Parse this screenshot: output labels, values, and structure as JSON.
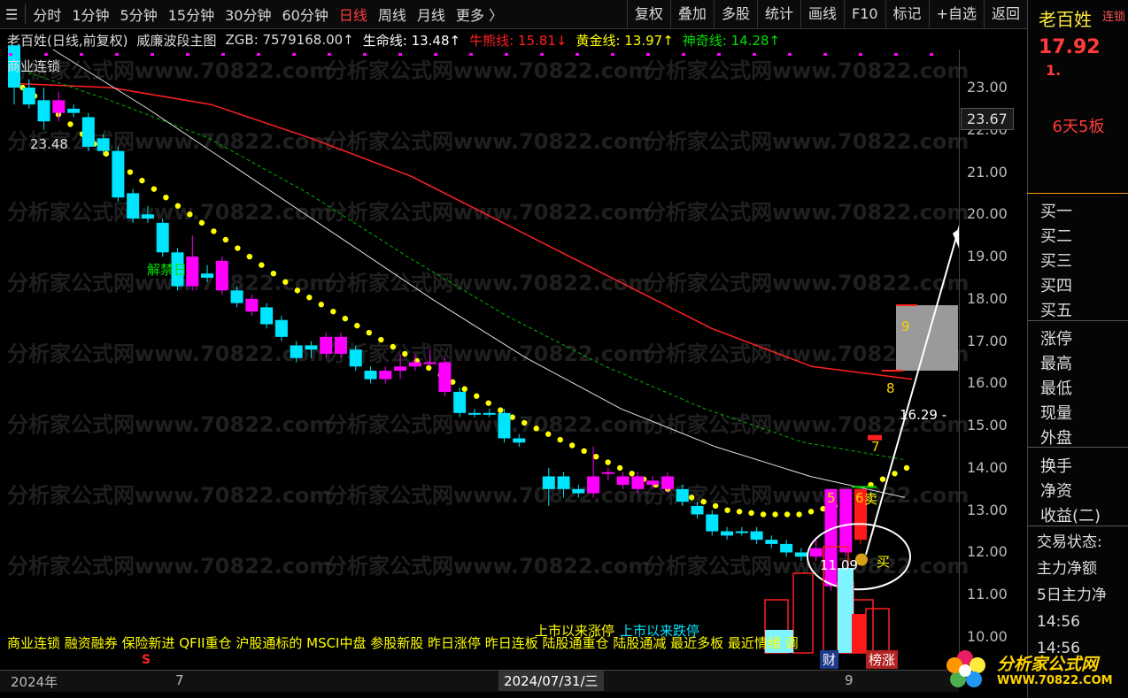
{
  "toolbar": {
    "tabs": [
      "分时",
      "1分钟",
      "5分钟",
      "15分钟",
      "30分钟",
      "60分钟",
      "日线",
      "周线",
      "月线",
      "更多 〉"
    ],
    "active_tab": "日线",
    "right_buttons": [
      "复权",
      "叠加",
      "多股",
      "统计",
      "画线",
      "F10",
      "标记",
      "+自选",
      "返回"
    ]
  },
  "legend": {
    "stock": "老百姓(日线,前复权)",
    "indicator": "威廉波段主图",
    "zgb": "ZGB: 7579168.00↑",
    "life": "生命线: 13.48↑",
    "bull": "牛熊线: 15.81↓",
    "gold": "黄金线: 13.97↑",
    "magic": "神奇线: 14.28↑"
  },
  "labels": {
    "sector": "商业连锁",
    "high_price": "23.48",
    "low_price": "11.09",
    "unlock_day": "解禁日",
    "buy": "买",
    "sell": "卖",
    "target": "16.29 -",
    "limit_up_text": "上市以来涨停",
    "limit_down_text": "上市以来跌停",
    "signal_s": "S",
    "signal_9": "9",
    "signal_8": "8",
    "signal_7": "7",
    "signal_5": "5",
    "signal_6": "6",
    "badge_cai": "财",
    "badge_bang": "榜涨"
  },
  "concept_strip": "商业连锁 融资融券 保险新进 QFII重仓 沪股通标的 MSCI中盘 参股新股 昨日涨停 昨日连板 陆股通重仓 陆股通减 最近多板 最近情绪 调",
  "price_axis": {
    "top_tag": "23.67",
    "ticks": [
      "23.00",
      "22.00",
      "21.00",
      "20.00",
      "19.00",
      "18.00",
      "17.00",
      "16.00",
      "15.00",
      "14.00",
      "13.00",
      "12.00",
      "11.00",
      "10.00"
    ]
  },
  "bottom_bar": {
    "year": "2024年",
    "month_mark": "7",
    "date": "2024/07/31/三",
    "month_end": "9"
  },
  "side_panel": {
    "name": "老百姓",
    "limit_tag": "连锁",
    "price": "17.92",
    "price_suffix": "1.",
    "board": "6天5板",
    "orders": [
      "买一",
      "买二",
      "买三",
      "买四",
      "买五"
    ],
    "quote": [
      "涨停",
      "最高",
      "最低",
      "现量",
      "外盘"
    ],
    "finance": [
      "换手",
      "净资",
      "收益(二)"
    ],
    "trade_title": "交易状态:",
    "trade": [
      "主力净额",
      "5日主力净",
      "14:56",
      "14:56"
    ]
  },
  "watermark": "分析家公式网www.70822.com",
  "logo": {
    "name": "分析家公式网",
    "url": "WWW.70822.COM"
  },
  "colors": {
    "up": "#ff00ff",
    "down": "#00e5ff",
    "red": "#ff2020",
    "yellow": "#ffff00",
    "green": "#00c000",
    "white": "#e0e0e0"
  },
  "chart_data": {
    "type": "candlestick",
    "ylim": [
      10,
      23.9
    ],
    "candles": [
      [
        24.0,
        23.0,
        24.0,
        22.6,
        "d"
      ],
      [
        23.0,
        22.6,
        23.2,
        22.5,
        "d"
      ],
      [
        22.7,
        22.2,
        23.0,
        22.0,
        "d"
      ],
      [
        22.4,
        22.7,
        22.9,
        22.2,
        "u"
      ],
      [
        22.5,
        22.4,
        22.6,
        22.3,
        "d"
      ],
      [
        22.3,
        21.6,
        22.4,
        21.5,
        "d"
      ],
      [
        21.8,
        21.5,
        21.9,
        21.4,
        "d"
      ],
      [
        21.5,
        20.4,
        21.6,
        20.3,
        "d"
      ],
      [
        20.5,
        19.9,
        20.6,
        19.8,
        "d"
      ],
      [
        20.0,
        19.9,
        20.2,
        19.8,
        "d"
      ],
      [
        19.8,
        19.1,
        19.9,
        19.0,
        "d"
      ],
      [
        19.1,
        18.3,
        19.2,
        18.2,
        "d"
      ],
      [
        18.3,
        19.0,
        19.5,
        18.2,
        "u"
      ],
      [
        18.5,
        18.6,
        18.8,
        18.4,
        "d"
      ],
      [
        18.9,
        18.2,
        19.0,
        18.1,
        "u"
      ],
      [
        18.2,
        17.9,
        18.3,
        17.8,
        "d"
      ],
      [
        18.0,
        17.7,
        18.1,
        17.6,
        "u"
      ],
      [
        17.8,
        17.4,
        17.9,
        17.3,
        "d"
      ],
      [
        17.5,
        17.1,
        17.6,
        17.0,
        "d"
      ],
      [
        16.9,
        16.6,
        17.0,
        16.5,
        "d"
      ],
      [
        16.8,
        16.9,
        17.0,
        16.6,
        "d"
      ],
      [
        16.7,
        17.1,
        17.2,
        16.6,
        "u"
      ],
      [
        17.1,
        16.7,
        17.2,
        16.6,
        "u"
      ],
      [
        16.8,
        16.4,
        16.9,
        16.3,
        "d"
      ],
      [
        16.3,
        16.1,
        16.4,
        16.0,
        "d"
      ],
      [
        16.1,
        16.3,
        16.4,
        16.0,
        "u"
      ],
      [
        16.3,
        16.4,
        16.7,
        16.1,
        "u"
      ],
      [
        16.4,
        16.5,
        16.7,
        16.3,
        "u"
      ],
      [
        16.5,
        16.5,
        16.8,
        16.4,
        "u"
      ],
      [
        16.5,
        15.8,
        16.6,
        15.7,
        "u"
      ],
      [
        15.8,
        15.3,
        15.9,
        15.2,
        "d"
      ],
      [
        15.3,
        15.3,
        15.4,
        15.2,
        "d"
      ],
      [
        15.3,
        15.3,
        15.4,
        15.2,
        "d"
      ],
      [
        15.3,
        14.7,
        15.4,
        14.6,
        "d"
      ],
      [
        14.7,
        14.6,
        14.8,
        14.5,
        "d"
      ],
      [
        null,
        null,
        null,
        null,
        "x"
      ],
      [
        13.8,
        13.5,
        14.0,
        13.1,
        "d"
      ],
      [
        13.8,
        13.5,
        13.9,
        13.3,
        "d"
      ],
      [
        13.5,
        13.4,
        13.6,
        13.3,
        "d"
      ],
      [
        13.4,
        13.8,
        14.5,
        13.3,
        "u"
      ],
      [
        13.9,
        13.9,
        14.0,
        13.7,
        "u"
      ],
      [
        13.8,
        13.6,
        13.9,
        13.5,
        "u"
      ],
      [
        13.5,
        13.8,
        13.9,
        13.4,
        "u"
      ],
      [
        13.7,
        13.6,
        13.8,
        13.5,
        "u"
      ],
      [
        13.8,
        13.5,
        13.9,
        13.4,
        "u"
      ],
      [
        13.5,
        13.2,
        13.6,
        13.1,
        "d"
      ],
      [
        13.1,
        12.9,
        13.2,
        12.8,
        "d"
      ],
      [
        12.9,
        12.5,
        13.0,
        12.4,
        "d"
      ],
      [
        12.5,
        12.4,
        12.6,
        12.3,
        "d"
      ],
      [
        12.5,
        12.5,
        12.6,
        12.4,
        "d"
      ],
      [
        12.5,
        12.3,
        12.6,
        12.2,
        "d"
      ],
      [
        12.3,
        12.2,
        12.4,
        12.1,
        "d"
      ],
      [
        12.2,
        12.0,
        12.3,
        11.9,
        "d"
      ],
      [
        12.0,
        11.9,
        12.1,
        11.8,
        "d"
      ],
      [
        11.9,
        12.1,
        12.3,
        11.8,
        "u"
      ],
      [
        11.2,
        13.5,
        13.5,
        11.1,
        "u"
      ],
      [
        12.0,
        13.5,
        13.5,
        11.9,
        "u"
      ],
      [
        13.5,
        12.3,
        13.5,
        12.2,
        "r"
      ]
    ],
    "ma_yellow_dots": [
      23.2,
      22.6,
      21.9,
      21.2,
      20.6,
      20.0,
      19.4,
      18.8,
      18.2,
      17.7,
      17.2,
      16.7,
      16.2,
      15.7,
      15.2,
      14.8,
      14.4,
      14.0,
      13.6,
      13.3,
      13.0,
      12.9,
      12.9,
      13.1,
      13.6,
      14.0
    ],
    "ma_white": [
      23.9,
      22.5,
      21.0,
      19.5,
      18.0,
      16.6,
      15.4,
      14.5,
      13.8,
      13.3
    ],
    "ma_green": [
      23.5,
      22.7,
      21.8,
      20.5,
      19.0,
      17.6,
      16.4,
      15.4,
      14.6,
      14.2
    ],
    "ma_red": [
      23.1,
      23.0,
      22.6,
      21.8,
      20.9,
      19.7,
      18.5,
      17.3,
      16.4,
      16.1
    ]
  }
}
